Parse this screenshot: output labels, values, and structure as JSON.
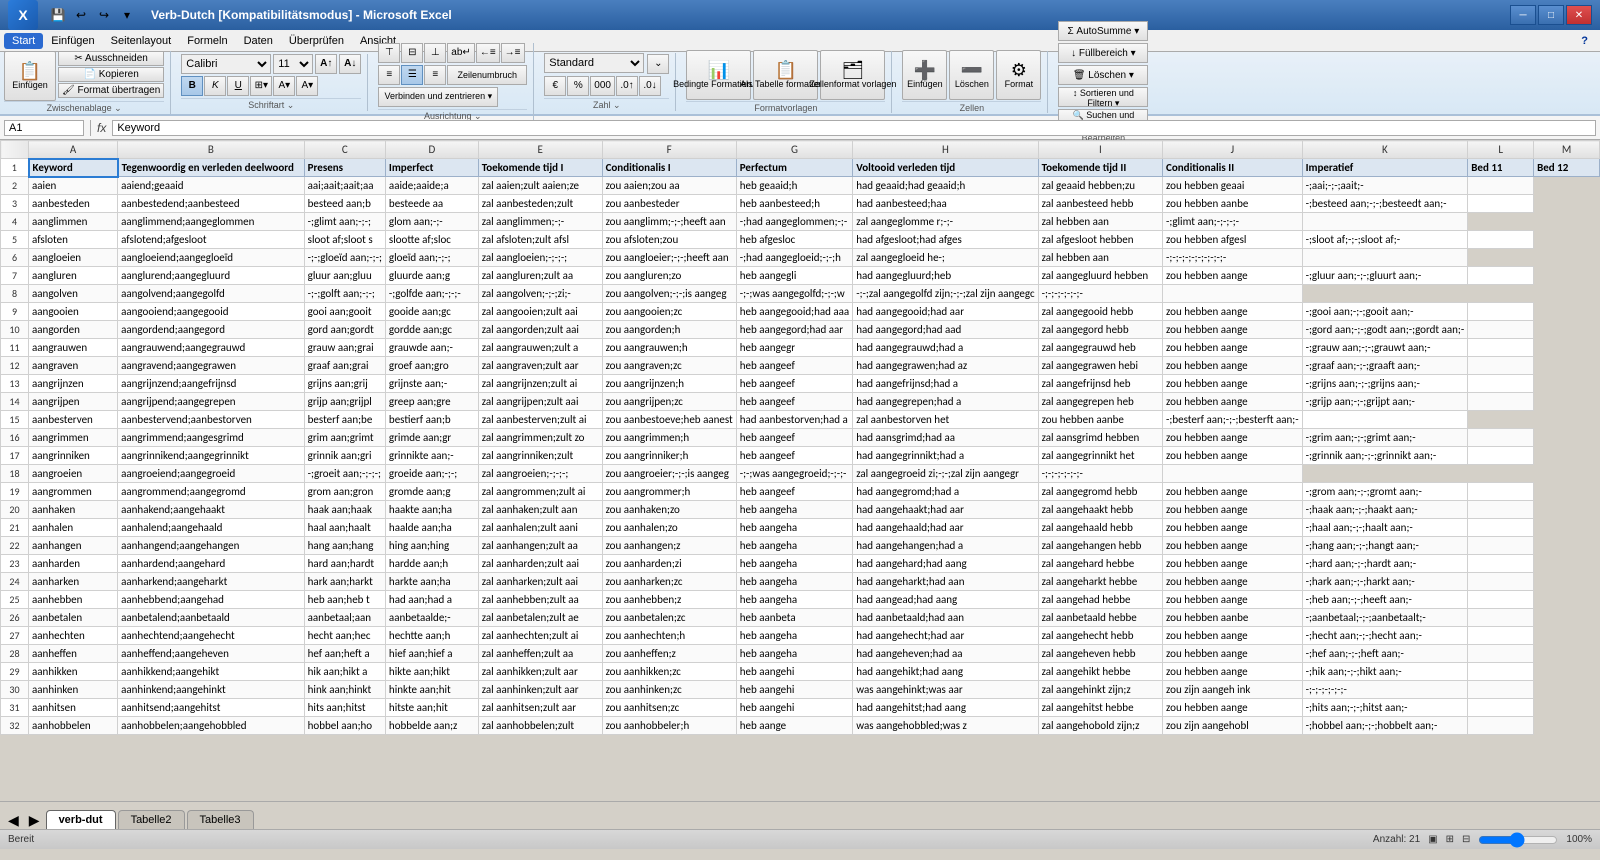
{
  "window": {
    "title": "Verb-Dutch [Kompatibilitätsmodus] - Microsoft Excel",
    "controls": [
      "minimize",
      "maximize",
      "close"
    ]
  },
  "menus": [
    "Start",
    "Einfügen",
    "Seitenlayout",
    "Formeln",
    "Daten",
    "Überprüfen",
    "Ansicht"
  ],
  "active_menu": "Start",
  "quick_access": [
    "save",
    "undo",
    "redo"
  ],
  "ribbon": {
    "groups": [
      {
        "label": "Zwischenablage",
        "buttons": [
          "Einfügen",
          "Ausschneiden",
          "Kopieren",
          "Format übertragen"
        ]
      },
      {
        "label": "Schriftart",
        "buttons": [
          "Calibri",
          "11",
          "B",
          "I",
          "U",
          "Rahmen",
          "Füllfarbe",
          "Schriftfarbe"
        ]
      },
      {
        "label": "Ausrichtung",
        "buttons": [
          "⬛",
          "⬛",
          "⬛",
          "⬛",
          "⬛",
          "⬛",
          "Zeilenumbruch",
          "Verbinden und zentrieren"
        ]
      },
      {
        "label": "Zahl",
        "buttons": [
          "Standard",
          "%",
          "Tausend",
          "Dezimal+",
          "Dezimal-"
        ]
      },
      {
        "label": "Formatvorlagen",
        "buttons": [
          "Bedingte Formatierung",
          "Als Tabelle formatieren",
          "Zellenformatvorlagen"
        ]
      },
      {
        "label": "Zellen",
        "buttons": [
          "Einfügen",
          "Löschen",
          "Format"
        ]
      },
      {
        "label": "Bearbeiten",
        "buttons": [
          "AutoSumme",
          "Füllbereich",
          "Löschen",
          "Sortieren und Filtern",
          "Suchen und Auswählen"
        ]
      }
    ]
  },
  "formula_bar": {
    "cell_ref": "A1",
    "formula": "Keyword"
  },
  "columns": {
    "headers": [
      "A",
      "B",
      "C",
      "D",
      "E",
      "F",
      "G",
      "H",
      "I",
      "J",
      "K",
      "L",
      "M"
    ],
    "labels": [
      "Keyword",
      "Tegenwoordig en verleden deelwoord",
      "Presens",
      "Imperfect",
      "Toekomende tijd I",
      "Conditionalis I",
      "Perfectum",
      "Voltooid verleden tijd",
      "Toekomende tijd II",
      "Conditionalis II",
      "Imperatief",
      "Bed 11",
      "Bed 12"
    ]
  },
  "rows": [
    [
      "aaien",
      "aaiend;geaaid",
      "aai;aait;aait;aa",
      "aaide;aaide;a",
      "zal aaien;zult aaien;ze",
      "zou aaien;zou aa",
      "heb geaaid;h",
      "had geaaid;had geaaid;h",
      "zal geaaid hebben;zu",
      "zou hebben geaai",
      "-;aai;-;-;aait;-",
      ""
    ],
    [
      "aanbesteden",
      "aanbestedend;aanbesteed",
      "besteed aan;b",
      "besteede aa",
      "zal aanbesteden;zult",
      "zou aanbesteder",
      "heb aanbesteed;h",
      "had aanbesteed;haa",
      "zal aanbesteed hebb",
      "zou hebben aanbe",
      "-;besteed aan;-;-;besteedt aan;-",
      ""
    ],
    [
      "aanglimmen",
      "aanglimmend;aangeglommen",
      "-;glimt aan;-;-;",
      "glom aan;-;-",
      "zal aanglimmen;-;-",
      "zou aanglimm;-;-;heeft aan",
      "-;had aangeglommen;-;-",
      "zal aangeglomme r;-;-",
      "zal hebben aan",
      "-;glimt aan;-;-;-;-",
      ""
    ],
    [
      "afsloten",
      "afslotend;afgesloot",
      "sloot af;sloot s",
      "slootte af;sloc",
      "zal afsloten;zult afsl",
      "zou afsloten;zou",
      "heb afgesloc",
      "had afgesloot;had afges",
      "zal afgesloot hebben",
      "zou hebben afgesl",
      "-;sloot af;-;-;sloot af;-",
      ""
    ],
    [
      "aangloeien",
      "aangloeiend;aangegloeïd",
      "-;-;gloeïd aan;-;-;",
      "gloeïd aan;-;-;",
      "zal aangloeien;-;-;-;",
      "zou aangloeier;-;-;heeft aan",
      "-;had aangegloeid;-;-;h",
      "zal aangegloeid he-;",
      "zal hebben aan",
      "-;-;-;-;-;-;-;-;-;-",
      ""
    ],
    [
      "aangluren",
      "aanglurend;aangegluurd",
      "gluur aan;gluu",
      "gluurde aan;g",
      "zal aangluren;zult aa",
      "zou aangluren;zo",
      "heb aangegli",
      "had aangegluurd;heb",
      "zal aangegluurd hebben",
      "zou hebben aange",
      "-;gluur aan;-;-;gluurt aan;-",
      ""
    ],
    [
      "aangolven",
      "aangolvend;aangegolfd",
      "-;-;golft aan;-;-;",
      "-;golfde aan;-;-;-",
      "zal aangolven;-;-;zi;-",
      "zou aangolven;-;-;is aangeg",
      "-;-;was aangegolfd;-;-;w",
      "-;-;zal aangegolfd zijn;-;-;zal zijn aangegc",
      "-;-;-;-;-;-;-",
      ""
    ],
    [
      "aangooien",
      "aangooiend;aangegooid",
      "gooi aan;gooit",
      "gooide aan;gc",
      "zal aangooien;zult aai",
      "zou aangooien;zc",
      "heb aangegooid;had aaa",
      "had aangegooid;had aar",
      "zal aangegooid hebb",
      "zou hebben aange",
      "-;gooi aan;-;-;gooit aan;-",
      ""
    ],
    [
      "aangorden",
      "aangordend;aangegord",
      "gord aan;gordt",
      "gordde aan;gc",
      "zal aangorden;zult aai",
      "zou aangorden;h",
      "heb aangegord;had aar",
      "had aangegord;had aad",
      "zal aangegord hebb",
      "zou hebben aange",
      "-;gord aan;-;-;godt aan;-;gordt aan;-",
      ""
    ],
    [
      "aangrauwen",
      "aangrauwend;aangegrauwd",
      "grauw aan;grai",
      "grauwde aan;-",
      "zal aangrauwen;zult a",
      "zou aangrauwen;h",
      "heb aangegr",
      "had aangegrauwd;had a",
      "zal aangegrauwd heb",
      "zou hebben aange",
      "-;grauw aan;-;-;grauwt aan;-",
      ""
    ],
    [
      "aangraven",
      "aangravend;aangegrawen",
      "graaf aan;grai",
      "groef aan;gro",
      "zal aangraven;zult aar",
      "zou aangraven;zc",
      "heb aangeef",
      "had aangegrawen;had az",
      "zal aangegrawen hebi",
      "zou hebben aange",
      "-;graaf aan;-;-;graaft aan;-",
      ""
    ],
    [
      "aangrijnzen",
      "aangrijnzend;aangefrijnsd",
      "grijns aan;grij",
      "grijnste aan;-",
      "zal aangrijnzen;zult ai",
      "zou aangrijnzen;h",
      "heb aangeef",
      "had aangefrijnsd;had a",
      "zal aangefrijnsd heb",
      "zou hebben aange",
      "-;grijns aan;-;-;grijns aan;-",
      ""
    ],
    [
      "aangrijpen",
      "aangrijpend;aangegrepen",
      "grijp aan;grijpl",
      "greep aan;gre",
      "zal aangrijpen;zult aai",
      "zou aangrijpen;zc",
      "heb aangeef",
      "had aangegrepen;had a",
      "zal aangegrepen heb",
      "zou hebben aange",
      "-;grijp aan;-;-;grijpt aan;-",
      ""
    ],
    [
      "aanbesterven",
      "aanbestervend;aanbestorven",
      "besterf aan;be",
      "bestierf aan;b",
      "zal aanbesterven;zult ai",
      "zou aanbestoeve;heb aanest",
      "had aanbestorven;had a",
      "zal aanbestorven het",
      "zou hebben aanbe",
      "-;besterf aan;-;-;besterft aan;-",
      ""
    ],
    [
      "aangrimmen",
      "aangrimmend;aangesgrimd",
      "grim aan;grimt",
      "grimde aan;gr",
      "zal aangrimmen;zult zo",
      "zou aangrimmen;h",
      "heb aangeef",
      "had aansgrimd;had aa",
      "zal aansgrimd hebben",
      "zou hebben aange",
      "-;grim aan;-;-;grimt aan;-",
      ""
    ],
    [
      "aangrinniken",
      "aangrinnikend;aangegrinnikt",
      "grinnik aan;gri",
      "grinnikte aan;-",
      "zal aangrinniken;zult",
      "zou aangrinniker;h",
      "heb aangeef",
      "had aangegrinnikt;had a",
      "zal aangegrinnikt het",
      "zou hebben aange",
      "-;grinnik aan;-;-;grinnikt aan;-",
      ""
    ],
    [
      "aangroeien",
      "aangroeiend;aangegroeid",
      "-;groeit aan;-;-;-;",
      "groeide aan;-;-;",
      "zal aangroeien;-;-;-;",
      "zou aangroeier;-;-;is aangeg",
      "-;-;was aangegroeid;-;-;-",
      "zal aangegroeid zi;-;-;zal zijn aangegr",
      "-;-;-;-;-;-;-",
      ""
    ],
    [
      "aangrommen",
      "aangrommend;aangegromd",
      "grom aan;gron",
      "gromde aan;g",
      "zal aangrommen;zult ai",
      "zou aangrommer;h",
      "heb aangeef",
      "had aangegromd;had a",
      "zal aangegromd hebb",
      "zou hebben aange",
      "-;grom aan;-;-;gromt aan;-",
      ""
    ],
    [
      "aanhaken",
      "aanhakend;aangehaakt",
      "haak aan;haak",
      "haakte aan;ha",
      "zal aanhaken;zult aan",
      "zou aanhaken;zo",
      "heb aangeha",
      "had aangehaakt;had aar",
      "zal aangehaakt hebb",
      "zou hebben aange",
      "-;haak aan;-;-;haakt aan;-",
      ""
    ],
    [
      "aanhalen",
      "aanhalend;aangehaald",
      "haal aan;haalt",
      "haalde aan;ha",
      "zal aanhalen;zult aani",
      "zou aanhalen;zo",
      "heb aangeha",
      "had aangehaald;had aar",
      "zal aangehaald hebb",
      "zou hebben aange",
      "-;haal aan;-;-;haalt aan;-",
      ""
    ],
    [
      "aanhangen",
      "aanhangend;aangehangen",
      "hang aan;hang",
      "hing aan;hing",
      "zal aanhangen;zult aa",
      "zou aanhangen;z",
      "heb aangeha",
      "had aangehangen;had a",
      "zal aangehangen hebb",
      "zou hebben aange",
      "-;hang aan;-;-;hangt aan;-",
      ""
    ],
    [
      "aanharden",
      "aanhardend;aangehard",
      "hard aan;hardt",
      "hardde aan;h",
      "zal aanharden;zult aai",
      "zou aanharden;zi",
      "heb aangeha",
      "had aangehard;had aang",
      "zal aangehard hebbe",
      "zou hebben aange",
      "-;hard aan;-;-;hardt aan;-",
      ""
    ],
    [
      "aanharken",
      "aanharkend;aangeharkt",
      "hark aan;harkt",
      "harkte aan;ha",
      "zal aanharken;zult aai",
      "zou aanharken;zc",
      "heb aangeha",
      "had aangeharkt;had aan",
      "zal aangeharkt hebbe",
      "zou hebben aange",
      "-;hark aan;-;-;harkt aan;-",
      ""
    ],
    [
      "aanhebben",
      "aanhebbend;aangehad",
      "heb aan;heb t",
      "had aan;had a",
      "zal aanhebben;zult aa",
      "zou aanhebben;z",
      "heb aangeha",
      "had aangead;had aang",
      "zal aangehad hebbe",
      "zou hebben aange",
      "-;heb aan;-;-;heeft aan;-",
      ""
    ],
    [
      "aanbetalen",
      "aanbetalend;aanbetaald",
      "aanbetaal;aan",
      "aanbetaalde;-",
      "zal aanbetalen;zult ae",
      "zou aanbetalen;zc",
      "heb aanbeta",
      "had aanbetaald;had aan",
      "zal aanbetaald hebbe",
      "zou hebben aanbe",
      "-;aanbetaal;-;-;aanbetaalt;-",
      ""
    ],
    [
      "aanhechten",
      "aanhechtend;aangehecht",
      "hecht aan;hec",
      "hechtte aan;h",
      "zal aanhechten;zult ai",
      "zou aanhechten;h",
      "heb aangeha",
      "had aangehecht;had aar",
      "zal aangehecht hebb",
      "zou hebben aange",
      "-;hecht aan;-;-;hecht aan;-",
      ""
    ],
    [
      "aanheffen",
      "aanheffend;aangeheven",
      "hef aan;heft a",
      "hief aan;hief a",
      "zal aanheffen;zult aa",
      "zou aanheffen;z",
      "heb aangeha",
      "had aangeheven;had aa",
      "zal aangeheven hebb",
      "zou hebben aange",
      "-;hef aan;-;-;heft aan;-",
      ""
    ],
    [
      "aanhikken",
      "aanhikkend;aangehikt",
      "hik aan;hikt a",
      "hikte aan;hikt",
      "zal aanhikken;zult aar",
      "zou aanhikken;zc",
      "heb aangehi",
      "had aangehikt;had aang",
      "zal aangehikt hebbe",
      "zou hebben aange",
      "-;hik aan;-;-;hikt aan;-",
      ""
    ],
    [
      "aanhinken",
      "aanhinkend;aangehinkt",
      "hink aan;hinkt",
      "hinkte aan;hit",
      "zal aanhinken;zult aar",
      "zou aanhinken;zc",
      "heb aangehi",
      "was aangehinkt;was aar",
      "zal aangehinkt zijn;z",
      "zou zijn aangeh ink",
      "-;-;-;-;-;-;-",
      ""
    ],
    [
      "aanhitsen",
      "aanhitsend;aangehitst",
      "hits aan;hitst",
      "hitste aan;hit",
      "zal aanhitsen;zult aar",
      "zou aanhitsen;zc",
      "heb aangehi",
      "had aangehitst;had aang",
      "zal aangehitst hebbe",
      "zou hebben aange",
      "-;hits aan;-;-;hitst aan;-",
      ""
    ],
    [
      "aanhobbelen",
      "aanhobbelen;aangehobbled",
      "hobbel aan;ho",
      "hobbelde aan;z",
      "zal aanhobbelen;zult",
      "zou aanhobbeler;h",
      "heb aange",
      "was aangehobbled;was z",
      "zal aangehobold zijn;z",
      "zou zijn aangehobl",
      "-;hobbel aan;-;-;hobbelt aan;-",
      ""
    ]
  ],
  "sheet_tabs": [
    "verb-dut",
    "Tabelle2",
    "Tabelle3"
  ],
  "active_tab": "verb-dut",
  "status": {
    "left": "Bereit",
    "middle": "Anzahl: 21",
    "right": "100%"
  },
  "help_icon": "?",
  "zoom_level": "100%"
}
